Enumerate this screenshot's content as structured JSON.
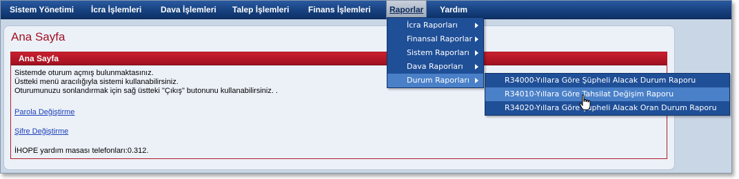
{
  "menubar": {
    "items": [
      {
        "label": "Sistem Yönetimi"
      },
      {
        "label": "İcra İşlemleri"
      },
      {
        "label": "Dava İşlemleri"
      },
      {
        "label": "Talep İşlemleri"
      },
      {
        "label": "Finans İşlemleri"
      },
      {
        "label": "Raporlar"
      },
      {
        "label": "Yardım"
      }
    ]
  },
  "raporlar_menu": {
    "items": [
      {
        "label": "İcra Raporları"
      },
      {
        "label": "Finansal Raporlar"
      },
      {
        "label": "Sistem Raporları"
      },
      {
        "label": "Dava Raporları"
      },
      {
        "label": "Durum Raporları"
      }
    ]
  },
  "durum_submenu": {
    "items": [
      {
        "label": "R34000-Yıllara Göre Şüpheli Alacak Durum Raporu"
      },
      {
        "label": "R34010-Yıllara Göre Tahsilat Değişim Raporu"
      },
      {
        "label": "R34020-Yıllara Göre Şüpheli Alacak Oran Durum Raporu"
      }
    ]
  },
  "page": {
    "title": "Ana Sayfa",
    "box_title": "Ana Sayfa",
    "line1": "Sistemde oturum açmış bulunmaktasınız.",
    "line2": "Üstteki menü aracılığıyla sistemi kullanabilirsiniz.",
    "line3": "Oturumunuzu sonlandırmak için sağ üstteki \"Çıkış\" butonunu kullanabilirsiniz. .",
    "link_parola": "Parola Değiştirme",
    "link_sifre": "Şifre Değiştirme",
    "helpdesk": "İHOPE yardım masası telefonları:0.312."
  },
  "colors": {
    "menubar": "#17417f",
    "accent_red": "#a01020",
    "menu_highlight": "#4a80c8",
    "link": "#1a3eb8"
  }
}
